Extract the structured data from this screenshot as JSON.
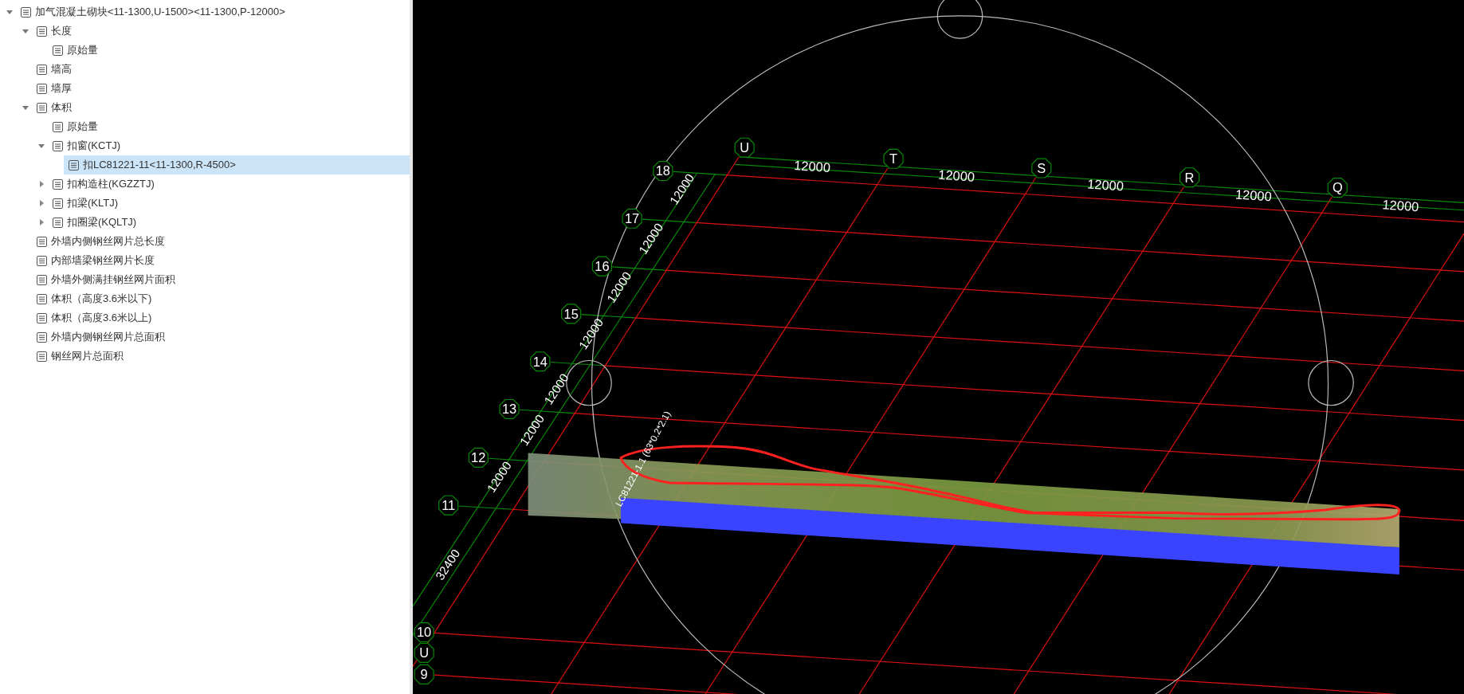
{
  "tree": [
    {
      "label": "加气混凝土砌块<11-1300,U-1500><11-1300,P-12000>",
      "expanded": true,
      "selected": false,
      "children": [
        {
          "label": "长度",
          "expanded": true,
          "selected": false,
          "children": [
            {
              "label": "原始量",
              "selected": false
            }
          ]
        },
        {
          "label": "墙高",
          "selected": false
        },
        {
          "label": "墙厚",
          "selected": false
        },
        {
          "label": "体积",
          "expanded": true,
          "selected": false,
          "children": [
            {
              "label": "原始量",
              "selected": false
            },
            {
              "label": "扣窗(KCTJ)",
              "expanded": true,
              "selected": false,
              "children": [
                {
                  "label": "扣LC81221-11<11-1300,R-4500>",
                  "selected": true
                }
              ]
            },
            {
              "label": "扣构造柱(KGZZTJ)",
              "expanded": false,
              "selected": false
            },
            {
              "label": "扣梁(KLTJ)",
              "expanded": false,
              "selected": false
            },
            {
              "label": "扣圈梁(KQLTJ)",
              "expanded": false,
              "selected": false
            }
          ]
        },
        {
          "label": "外墙内侧钢丝网片总长度",
          "selected": false
        },
        {
          "label": "内部墙梁钢丝网片长度",
          "selected": false
        },
        {
          "label": "外墙外侧满挂钢丝网片面积",
          "selected": false
        },
        {
          "label": "体积（高度3.6米以下)",
          "selected": false
        },
        {
          "label": "体积（高度3.6米以上)",
          "selected": false
        },
        {
          "label": "外墙内侧钢丝网片总面积",
          "selected": false
        },
        {
          "label": "钢丝网片总面积",
          "selected": false
        }
      ]
    }
  ],
  "canvas": {
    "column_axes": [
      "U",
      "T",
      "S",
      "R",
      "Q"
    ],
    "row_axes": [
      "18",
      "17",
      "16",
      "15",
      "14",
      "13",
      "12",
      "11",
      "10",
      "U",
      "9"
    ],
    "top_dimensions": [
      "12000",
      "12000",
      "12000",
      "12000",
      "12000"
    ],
    "side_dimensions": [
      "12000",
      "12000",
      "12000",
      "12000",
      "12000",
      "12000",
      "12000",
      "32400"
    ],
    "window_label": "LC81221-1.1 (63*0.2*2.1)"
  }
}
